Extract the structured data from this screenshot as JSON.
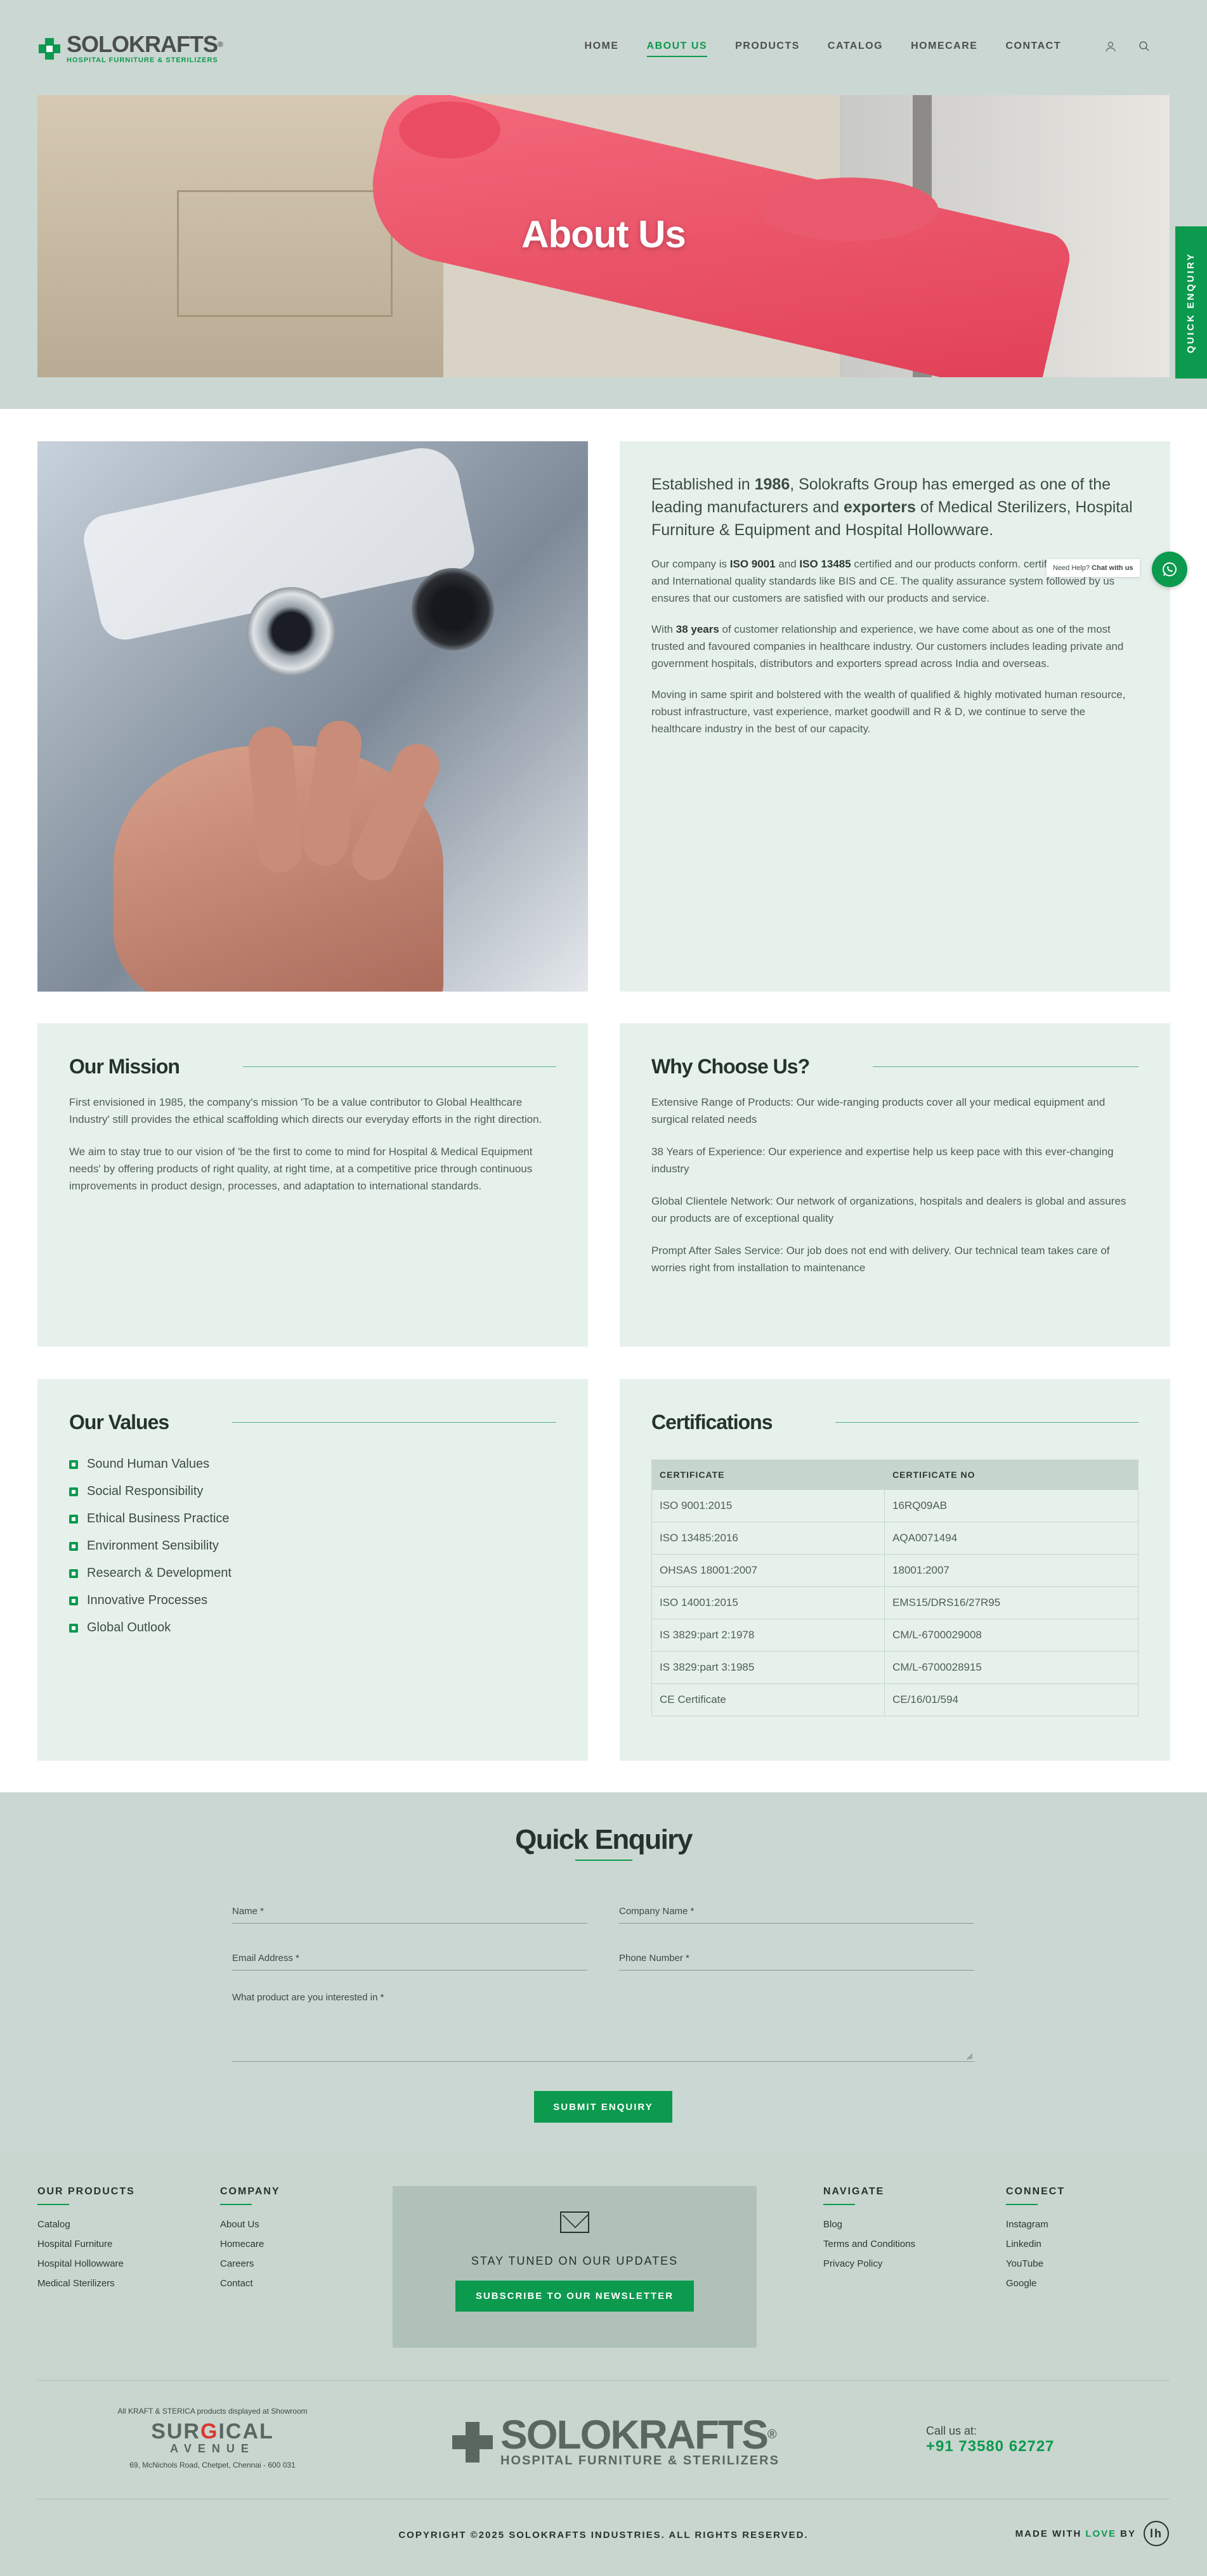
{
  "header": {
    "logo_name": "SOLOKRAFTS",
    "logo_reg": "®",
    "logo_tagline": "HOSPITAL FURNITURE & STERILIZERS",
    "nav": [
      "HOME",
      "ABOUT US",
      "PRODUCTS",
      "CATALOG",
      "HOMECARE",
      "CONTACT"
    ],
    "active_nav": "ABOUT US",
    "user_icon": "user-icon",
    "search_icon": "search-icon"
  },
  "hero": {
    "title": "About Us"
  },
  "quick_enquiry_tab": "QUICK ENQUIRY",
  "whatsapp": {
    "label_prefix": "Need Help?",
    "label_strong": "Chat with us",
    "icon": "whatsapp-icon"
  },
  "intro": {
    "lead_1": "Established in ",
    "lead_year": "1986",
    "lead_2": ", Solokrafts Group has emerged as one of the leading manufacturers and ",
    "lead_exporters": "exporters",
    "lead_3": " of Medical Sterilizers, Hospital Furniture & Equipment and Hospital Hollowware.",
    "p1_a": "Our company is ",
    "p1_iso1": "ISO 9001",
    "p1_b": " and ",
    "p1_iso2": "ISO 13485",
    "p1_c": " certified and our products conform. certified by National and International quality standards like BIS and CE. The quality assurance system followed by us ensures that our customers are satisfied with our products and service.",
    "p2_a": "With ",
    "p2_years": "38 years",
    "p2_b": " of customer relationship and experience, we have come about as one of the most trusted and favoured companies in healthcare industry. Our customers includes leading private and government hospitals, distributors and exporters spread across India and overseas.",
    "p3": "Moving in same spirit and bolstered with the wealth of qualified & highly motivated human resource, robust infrastructure, vast experience, market goodwill and R & D, we continue to serve the healthcare industry in the best of our capacity."
  },
  "mission": {
    "title": "Our Mission",
    "p1": "First envisioned in 1985, the company's mission 'To be a value contributor to Global Healthcare Industry' still provides the ethical scaffolding which directs our everyday efforts in the right direction.",
    "p2": "We aim to stay true to our vision of 'be the first to come to mind for Hospital & Medical Equipment needs' by offering products of right quality, at right time, at a competitive price through continuous improvements in product design, processes, and adaptation to international standards."
  },
  "why": {
    "title": "Why Choose Us?",
    "items": [
      "Extensive Range of Products: Our wide-ranging products cover all your medical equipment and surgical related needs",
      "38 Years of Experience: Our experience and expertise help us keep pace with this ever-changing industry",
      "Global Clientele Network: Our network of organizations, hospitals and dealers is global and assures our products are of exceptional quality",
      "Prompt After Sales Service: Our job does not end with delivery. Our technical team takes care of worries right from installation to maintenance"
    ]
  },
  "values": {
    "title": "Our Values",
    "items": [
      "Sound Human Values",
      "Social Responsibility",
      "Ethical Business Practice",
      "Environment Sensibility",
      "Research & Development",
      "Innovative Processes",
      "Global Outlook"
    ]
  },
  "certifications": {
    "title": "Certifications",
    "headers": [
      "CERTIFICATE",
      "CERTIFICATE NO"
    ],
    "rows": [
      [
        "ISO 9001:2015",
        "16RQ09AB"
      ],
      [
        "ISO 13485:2016",
        "AQA0071494"
      ],
      [
        "OHSAS 18001:2007",
        "18001:2007"
      ],
      [
        "ISO 14001:2015",
        "EMS15/DRS16/27R95"
      ],
      [
        "IS 3829:part 2:1978",
        "CM/L-6700029008"
      ],
      [
        "IS 3829:part 3:1985",
        "CM/L-6700028915"
      ],
      [
        "CE Certificate",
        "CE/16/01/594"
      ]
    ]
  },
  "enquiry": {
    "title": "Quick Enquiry",
    "name_label": "Name *",
    "company_label": "Company Name *",
    "email_label": "Email Address *",
    "phone_label": "Phone Number *",
    "product_label": "What product are you interested in *",
    "submit": "SUBMIT ENQUIRY"
  },
  "footer": {
    "products_title": "OUR PRODUCTS",
    "products": [
      "Catalog",
      "Hospital Furniture",
      "Hospital Hollowware",
      "Medical Sterilizers"
    ],
    "company_title": "COMPANY",
    "company": [
      "About Us",
      "Homecare",
      "Careers",
      "Contact"
    ],
    "newsletter_title": "STAY TUNED ON OUR UPDATES",
    "newsletter_button": "SUBSCRIBE TO OUR NEWSLETTER",
    "navigate_title": "NAVIGATE",
    "navigate": [
      "Blog",
      "Terms and Conditions",
      "Privacy Policy"
    ],
    "connect_title": "CONNECT",
    "connect": [
      "Instagram",
      "Linkedin",
      "YouTube",
      "Google"
    ],
    "showroom_note": "All KRAFT & STERICA products displayed at Showroom",
    "showroom_name_1": "SUR",
    "showroom_name_g": "G",
    "showroom_name_2": "ICAL",
    "showroom_sub": "AVENUE",
    "showroom_address": "69, McNichols Road, Chetpet, Chennai - 600 031",
    "brand_name": "SOLOKRAFTS",
    "brand_reg": "®",
    "brand_tagline": "HOSPITAL FURNITURE & STERILIZERS",
    "call_label": "Call us at:",
    "call_number": "+91 73580 62727",
    "copyright": "COPYRIGHT ©2025 SOLOKRAFTS INDUSTRIES. ALL RIGHTS RESERVED.",
    "made_with": "MADE WITH",
    "love": "LOVE",
    "by": "BY",
    "maker_logo": "lh"
  }
}
